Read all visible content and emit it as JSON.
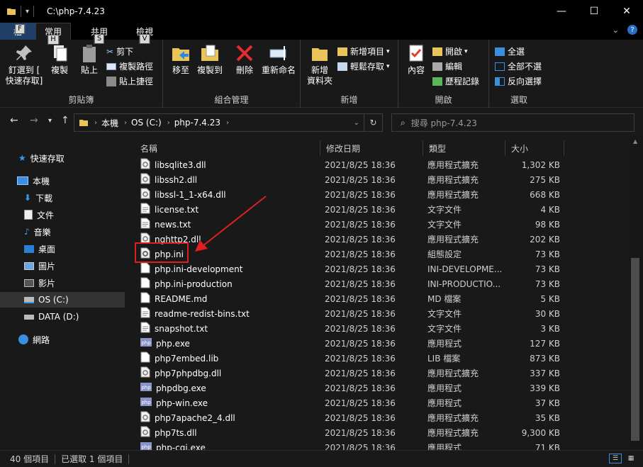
{
  "window": {
    "title": "C:\\php-7.4.23"
  },
  "ribbon_tabs": [
    {
      "label": "檔",
      "keytip": "F"
    },
    {
      "label": "常用",
      "keytip": "H"
    },
    {
      "label": "共用",
      "keytip": "S"
    },
    {
      "label": "檢視",
      "keytip": "V"
    }
  ],
  "ribbon": {
    "clipboard": {
      "group": "剪貼簿",
      "pin_l1": "釘選到 [",
      "pin_l2": "快速存取]",
      "copy": "複製",
      "paste": "貼上",
      "cut": "剪下",
      "copy_path": "複製路徑",
      "paste_shortcut": "貼上捷徑"
    },
    "organize": {
      "group": "組合管理",
      "move_to": "移至",
      "copy_to": "複製到",
      "delete": "刪除",
      "rename": "重新命名"
    },
    "new": {
      "group": "新增",
      "folder_l1": "新增",
      "folder_l2": "資料夾",
      "new_item": "新增項目",
      "easy_access": "輕鬆存取"
    },
    "open": {
      "group": "開啟",
      "properties": "內容",
      "open": "開啟",
      "edit": "編輯",
      "history": "歷程記錄"
    },
    "select": {
      "group": "選取",
      "select_all": "全選",
      "select_none": "全部不選",
      "invert": "反向選擇"
    }
  },
  "breadcrumb": [
    "本機",
    "OS (C:)",
    "php-7.4.23"
  ],
  "search": {
    "placeholder": "搜尋 php-7.4.23"
  },
  "sidebar": {
    "quick_access": "快速存取",
    "this_pc": "本機",
    "items": [
      "下載",
      "文件",
      "音樂",
      "桌面",
      "圖片",
      "影片",
      "OS (C:)",
      "DATA (D:)"
    ],
    "network": "網路"
  },
  "columns": {
    "name": "名稱",
    "date": "修改日期",
    "type": "類型",
    "size": "大小"
  },
  "files": [
    {
      "name": "libsqlite3.dll",
      "date": "2021/8/25 18:36",
      "type": "應用程式擴充",
      "size": "1,302 KB",
      "icon": "dll-icon"
    },
    {
      "name": "libssh2.dll",
      "date": "2021/8/25 18:36",
      "type": "應用程式擴充",
      "size": "275 KB",
      "icon": "dll-icon"
    },
    {
      "name": "libssl-1_1-x64.dll",
      "date": "2021/8/25 18:36",
      "type": "應用程式擴充",
      "size": "668 KB",
      "icon": "dll-icon"
    },
    {
      "name": "license.txt",
      "date": "2021/8/25 18:36",
      "type": "文字文件",
      "size": "4 KB",
      "icon": "text-file-icon"
    },
    {
      "name": "news.txt",
      "date": "2021/8/25 18:36",
      "type": "文字文件",
      "size": "98 KB",
      "icon": "text-file-icon"
    },
    {
      "name": "nghttp2.dll",
      "date": "2021/8/25 18:36",
      "type": "應用程式擴充",
      "size": "202 KB",
      "icon": "dll-icon"
    },
    {
      "name": "php.ini",
      "date": "2021/8/25 18:36",
      "type": "組態設定",
      "size": "73 KB",
      "icon": "config-file-icon"
    },
    {
      "name": "php.ini-development",
      "date": "2021/8/25 18:36",
      "type": "INI-DEVELOPME...",
      "size": "73 KB",
      "icon": "blank-file-icon"
    },
    {
      "name": "php.ini-production",
      "date": "2021/8/25 18:36",
      "type": "INI-PRODUCTIO...",
      "size": "73 KB",
      "icon": "blank-file-icon"
    },
    {
      "name": "README.md",
      "date": "2021/8/25 18:36",
      "type": "MD 檔案",
      "size": "5 KB",
      "icon": "blank-file-icon"
    },
    {
      "name": "readme-redist-bins.txt",
      "date": "2021/8/25 18:36",
      "type": "文字文件",
      "size": "30 KB",
      "icon": "text-file-icon"
    },
    {
      "name": "snapshot.txt",
      "date": "2021/8/25 18:36",
      "type": "文字文件",
      "size": "3 KB",
      "icon": "text-file-icon"
    },
    {
      "name": "php.exe",
      "date": "2021/8/25 18:36",
      "type": "應用程式",
      "size": "127 KB",
      "icon": "php-exe-icon"
    },
    {
      "name": "php7embed.lib",
      "date": "2021/8/25 18:36",
      "type": "LIB 檔案",
      "size": "873 KB",
      "icon": "blank-file-icon"
    },
    {
      "name": "php7phpdbg.dll",
      "date": "2021/8/25 18:36",
      "type": "應用程式擴充",
      "size": "337 KB",
      "icon": "dll-icon"
    },
    {
      "name": "phpdbg.exe",
      "date": "2021/8/25 18:36",
      "type": "應用程式",
      "size": "339 KB",
      "icon": "php-exe-icon"
    },
    {
      "name": "php-win.exe",
      "date": "2021/8/25 18:36",
      "type": "應用程式",
      "size": "37 KB",
      "icon": "php-exe-icon"
    },
    {
      "name": "php7apache2_4.dll",
      "date": "2021/8/25 18:36",
      "type": "應用程式擴充",
      "size": "35 KB",
      "icon": "dll-icon"
    },
    {
      "name": "php7ts.dll",
      "date": "2021/8/25 18:36",
      "type": "應用程式擴充",
      "size": "9,300 KB",
      "icon": "dll-icon"
    },
    {
      "name": "php-cgi.exe",
      "date": "2021/8/25 18:36",
      "type": "應用程式",
      "size": "71 KB",
      "icon": "php-exe-icon"
    }
  ],
  "status": {
    "count": "40 個項目",
    "selected": "已選取 1 個項目"
  },
  "colors": {
    "accent_red": "#e02020",
    "background": "#191919",
    "titlebar": "#000000"
  }
}
